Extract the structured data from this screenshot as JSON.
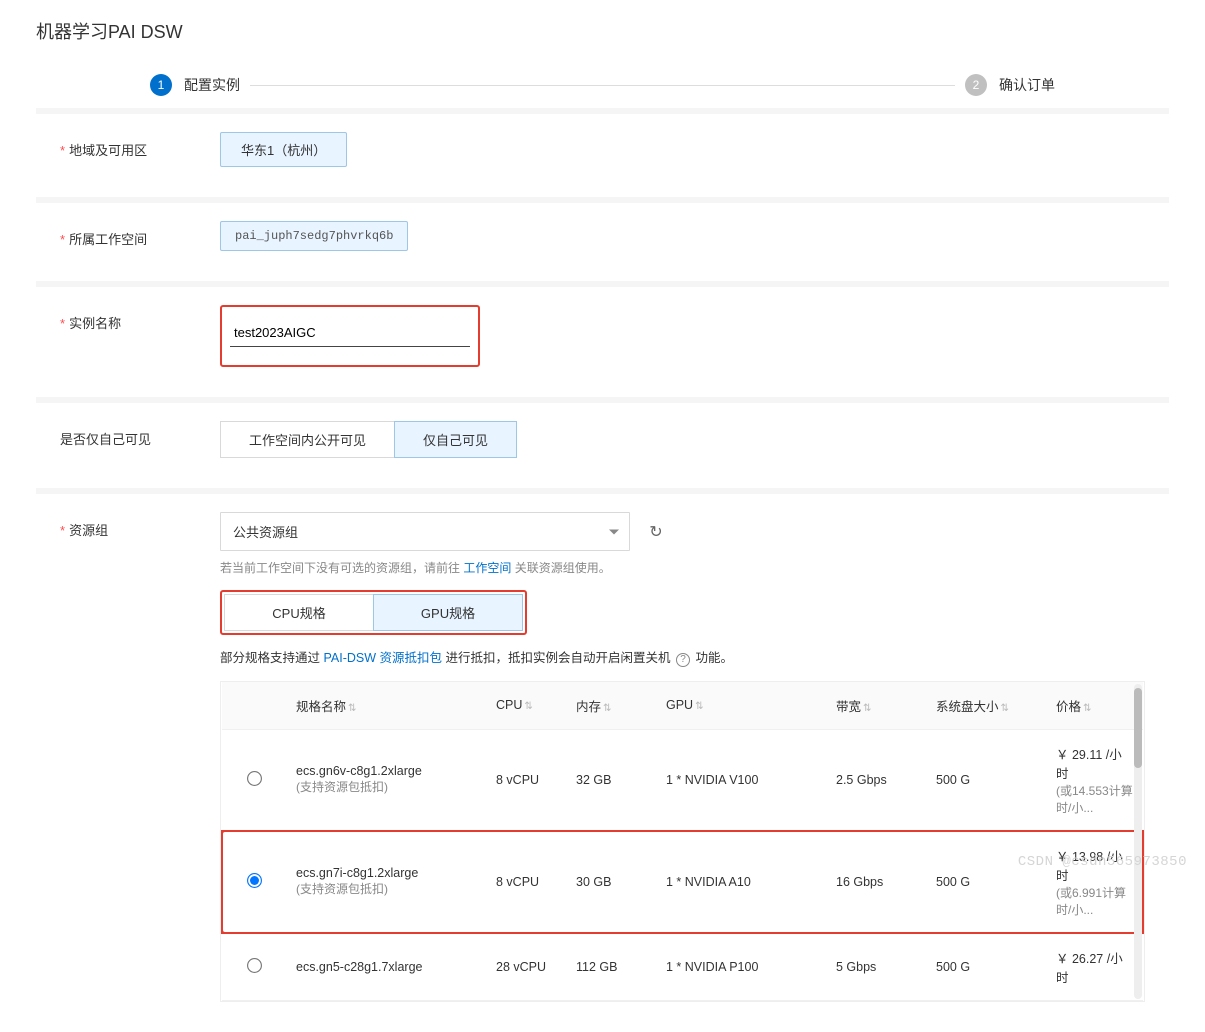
{
  "page_title": "机器学习PAI DSW",
  "wizard": {
    "step1_num": "1",
    "step1_label": "配置实例",
    "step2_num": "2",
    "step2_label": "确认订单"
  },
  "region": {
    "label": "地域及可用区",
    "value": "华东1（杭州）"
  },
  "workspace": {
    "label": "所属工作空间",
    "value": "pai_juph7sedg7phvrkq6b"
  },
  "instance_name": {
    "label": "实例名称",
    "value": "test2023AIGC"
  },
  "visibility": {
    "label": "是否仅自己可见",
    "public_label": "工作空间内公开可见",
    "private_label": "仅自己可见"
  },
  "resource_group": {
    "label": "资源组",
    "value": "公共资源组",
    "hint_pre": "若当前工作空间下没有可选的资源组，请前往 ",
    "hint_link": "工作空间",
    "hint_post": " 关联资源组使用。",
    "cpu_tab": "CPU规格",
    "gpu_tab": "GPU规格",
    "note_pre": "部分规格支持通过 ",
    "note_link": "PAI-DSW 资源抵扣包",
    "note_mid": " 进行抵扣，抵扣实例会自动开启闲置关机 ",
    "note_post": " 功能。"
  },
  "spec_table": {
    "headers": {
      "name": "规格名称",
      "cpu": "CPU",
      "memory": "内存",
      "gpu": "GPU",
      "bandwidth": "带宽",
      "disk": "系统盘大小",
      "price": "价格"
    },
    "rows": [
      {
        "name": "ecs.gn6v-c8g1.2xlarge",
        "sub": "(支持资源包抵扣)",
        "cpu": "8 vCPU",
        "memory": "32 GB",
        "gpu": "1 * NVIDIA V100",
        "bandwidth": "2.5 Gbps",
        "disk": "500 G",
        "price": "￥ 29.11 /小时",
        "price_sub": "(或14.553计算时/小..."
      },
      {
        "name": "ecs.gn7i-c8g1.2xlarge",
        "sub": "(支持资源包抵扣)",
        "cpu": "8 vCPU",
        "memory": "30 GB",
        "gpu": "1 * NVIDIA A10",
        "bandwidth": "16 Gbps",
        "disk": "500 G",
        "price": "￥ 13.98 /小时",
        "price_sub": "(或6.991计算时/小..."
      },
      {
        "name": "ecs.gn5-c28g1.7xlarge",
        "sub": "",
        "cpu": "28 vCPU",
        "memory": "112 GB",
        "gpu": "1 * NVIDIA P100",
        "bandwidth": "5 Gbps",
        "disk": "500 G",
        "price": "￥ 26.27 /小时",
        "price_sub": ""
      }
    ]
  },
  "watermark": "CSDN @csdn565973850"
}
